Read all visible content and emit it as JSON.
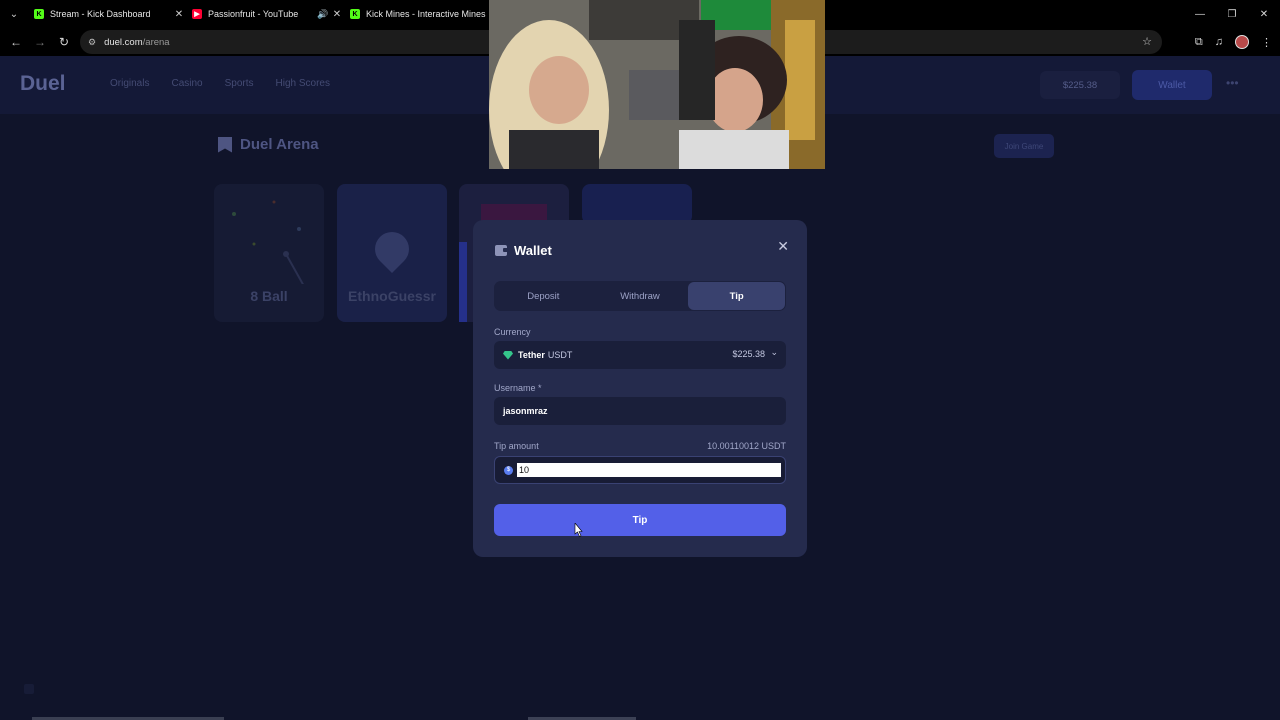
{
  "browser": {
    "tabs": [
      {
        "title": "Stream - Kick Dashboard",
        "favicon": "kick-icon",
        "color": "#53fc18"
      },
      {
        "title": "Passionfruit - YouTube",
        "favicon": "youtube-icon",
        "color": "#ff0033"
      },
      {
        "title": "Kick Mines - Interactive Mines (",
        "favicon": "kick-icon",
        "color": "#53fc18"
      }
    ],
    "url_host": "duel.com",
    "url_path": "/arena"
  },
  "site": {
    "logo": "Duel",
    "nav": [
      "Originals",
      "Casino",
      "Sports",
      "High Scores"
    ],
    "balance": "$225.38",
    "wallet_label": "Wallet",
    "section_title": "Duel Arena",
    "join_label": "Join Game",
    "cards": [
      {
        "label": "8 Ball"
      },
      {
        "label": "EthnoGuessr"
      }
    ]
  },
  "wallet_modal": {
    "title": "Wallet",
    "tabs": [
      {
        "label": "Deposit",
        "active": false
      },
      {
        "label": "Withdraw",
        "active": false
      },
      {
        "label": "Tip",
        "active": true
      }
    ],
    "currency_label": "Currency",
    "currency_name": "Tether",
    "currency_code": "USDT",
    "currency_balance": "$225.38",
    "username_label": "Username *",
    "username_value": "jasonmraz",
    "amount_label": "Tip amount",
    "amount_available": "10.00110012 USDT",
    "amount_value": "10",
    "submit_label": "Tip",
    "accent_color": "#5360e8"
  }
}
